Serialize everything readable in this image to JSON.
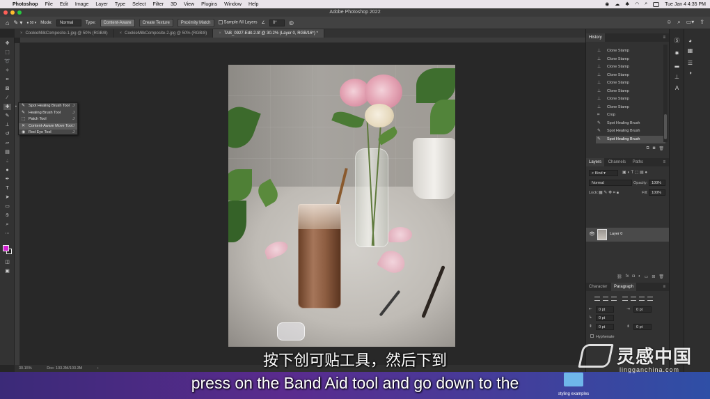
{
  "menubar": {
    "app": "Photoshop",
    "items": [
      "File",
      "Edit",
      "Image",
      "Layer",
      "Type",
      "Select",
      "Filter",
      "3D",
      "View",
      "Plugins",
      "Window",
      "Help"
    ],
    "clock": "Tue Jan 4  4:35 PM"
  },
  "window": {
    "title": "Adobe Photoshop 2022"
  },
  "options": {
    "brush_size": "50",
    "mode_label": "Mode:",
    "mode_value": "Normal",
    "type_label": "Type:",
    "type_buttons": [
      "Content-Aware",
      "Create Texture",
      "Proximity Match"
    ],
    "sample_all": "Sample All Layers",
    "angle": "0°"
  },
  "tabs": [
    {
      "label": "CookieMilkComposite-1.jpg @ 50% (RGB/8)",
      "active": false
    },
    {
      "label": "CookieMilkComposite-2.jpg @ 50% (RGB/8)",
      "active": false
    },
    {
      "label": "TAB_0927-Edit-2.tif @ 30.2% (Layer 0, RGB/16*) *",
      "active": true
    }
  ],
  "flyout": [
    {
      "label": "Spot Healing Brush Tool",
      "key": "J",
      "icon": "✎"
    },
    {
      "label": "Healing Brush Tool",
      "key": "J",
      "icon": "✎"
    },
    {
      "label": "Patch Tool",
      "key": "J",
      "icon": "⬚"
    },
    {
      "label": "Content-Aware Move Tool",
      "key": "J",
      "icon": "✕"
    },
    {
      "label": "Red Eye Tool",
      "key": "J",
      "icon": "◉"
    }
  ],
  "statusbar": {
    "zoom": "30.15%",
    "doc": "Doc: 103.3M/103.3M"
  },
  "history": {
    "title": "History",
    "items": [
      "Clone Stamp",
      "Clone Stamp",
      "Clone Stamp",
      "Clone Stamp",
      "Clone Stamp",
      "Clone Stamp",
      "Clone Stamp",
      "Clone Stamp",
      "Crop",
      "Spot Healing Brush",
      "Spot Healing Brush",
      "Spot Healing Brush"
    ]
  },
  "layers": {
    "tabs": [
      "Layers",
      "Channels",
      "Paths"
    ],
    "kind": "Kind",
    "blend": "Normal",
    "opacity_label": "Opacity:",
    "opacity": "100%",
    "lock_label": "Lock:",
    "fill_label": "Fill:",
    "fill": "100%",
    "layer_name": "Layer 0"
  },
  "paragraph": {
    "tabs": [
      "Character",
      "Paragraph"
    ],
    "fields": [
      "0 pt",
      "0 pt",
      "0 pt",
      "0 pt",
      "0 pt"
    ],
    "hyphenate": "Hyphenate"
  },
  "subtitles": {
    "chinese": "按下创可贴工具，然后下到",
    "english": "press on the Band Aid tool and go down to the"
  },
  "desktop": {
    "folder_label": "styling examples"
  },
  "watermark": {
    "brand": "灵感中国",
    "url": "lingganchina.com"
  },
  "colors": {
    "foreground": "#d322d3",
    "background": "#222222"
  }
}
